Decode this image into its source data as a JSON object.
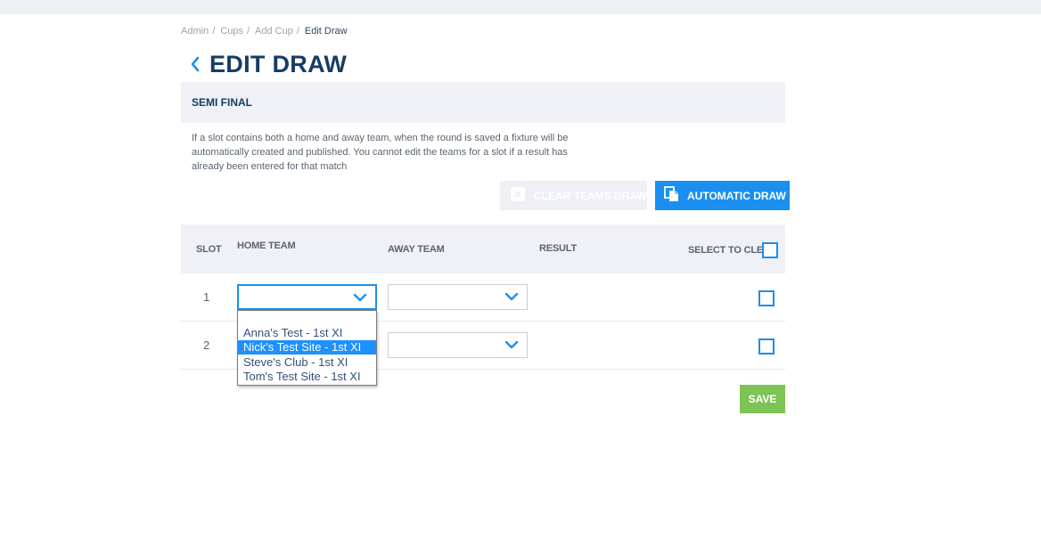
{
  "breadcrumb": {
    "items": [
      "Admin",
      "Cups",
      "Add Cup"
    ],
    "current": "Edit Draw",
    "separator": "/"
  },
  "page": {
    "title": "EDIT DRAW",
    "back_icon": "chevron-left-icon"
  },
  "round": {
    "title": "SEMI FINAL"
  },
  "info_text": "If a slot contains both a home and away team, when the round is saved a fixture will be automatically created and published. You cannot edit the teams for a slot if a result has already been entered for that match",
  "buttons": {
    "clear_teams_draw": "CLEAR TEAMS DRAW",
    "automatic_draw": "AUTOMATIC DRAW",
    "save": "SAVE"
  },
  "table": {
    "headers": {
      "slot": "SLOT",
      "home_team": "HOME TEAM",
      "away_team": "AWAY TEAM",
      "result": "RESULT",
      "select_to_clear": "SELECT TO CLEAR"
    },
    "rows": [
      {
        "slot": "1",
        "home_team": "",
        "away_team": "",
        "result": ""
      },
      {
        "slot": "2",
        "home_team": "",
        "away_team": "",
        "result": ""
      }
    ]
  },
  "home_dropdown": {
    "options": [
      "",
      "Anna's Test - 1st XI",
      "Nick's Test Site - 1st XI",
      "Steve's Club - 1st XI",
      "Tom's Test Site - 1st XI"
    ],
    "highlighted_index": 2
  },
  "colors": {
    "accent": "#1a8ff0",
    "title": "#163d63",
    "save": "#7cc454",
    "header_bg": "#f0f1f6"
  }
}
